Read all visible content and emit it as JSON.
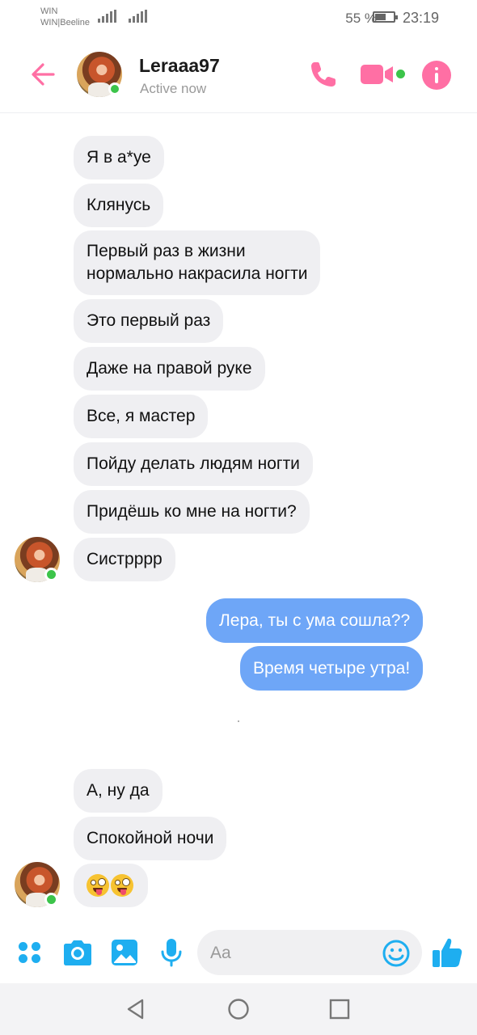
{
  "status_bar": {
    "carrier_line1": "WIN",
    "carrier_line2": "WIN|Beeline",
    "battery_percent": "55 %",
    "battery_level": 0.55,
    "time": "23:19"
  },
  "header": {
    "contact_name": "Leraaa97",
    "contact_status": "Active now",
    "icons": {
      "back": "arrow-left-icon",
      "call": "phone-icon",
      "video": "video-camera-icon",
      "info": "info-icon"
    }
  },
  "messages": {
    "m1": "Я в а*уе",
    "m2": "Клянусь",
    "m3_line1": "Первый раз в жизни",
    "m3_line2": "нормально накрасила ногти",
    "m4": "Это первый раз",
    "m5": "Даже на правой руке",
    "m6": "Все, я мастер",
    "m7": "Пойду делать людям ногти",
    "m8": "Придёшь ко мне на ногти?",
    "m9": "Систрррр",
    "m10": "Лера, ты с ума сошла??",
    "m11": "Время четыре утра!",
    "m12": "А, ну да",
    "m13": "Спокойной ночи",
    "m14_emoji": "zany-face-emoji x2"
  },
  "composer": {
    "placeholder": "Aa",
    "icons": [
      "menu-icon",
      "camera-icon",
      "image-icon",
      "mic-icon",
      "emoji-icon",
      "thumbs-up-icon"
    ]
  },
  "colors": {
    "accent_pink": "#ff6fa4",
    "outgoing_bubble": "#6ea6f7",
    "incoming_bubble": "#efeff2",
    "composer_blue": "#1eaef0",
    "online_green": "#3cc44a"
  }
}
